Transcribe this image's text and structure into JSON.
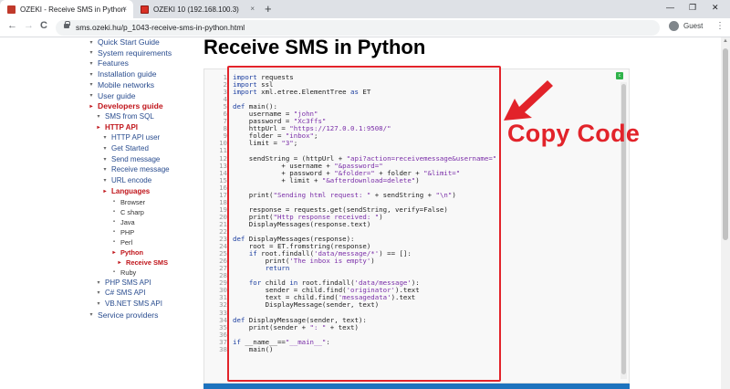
{
  "browser": {
    "tabs": [
      {
        "title": "OZEKI - Receive SMS in Python",
        "active": true,
        "favicon_color": "#c0392b"
      },
      {
        "title": "OZEKI 10 (192.168.100.3)",
        "active": false,
        "favicon_color": "#d93025"
      }
    ],
    "new_tab_label": "+",
    "close_label": "×",
    "window_controls": {
      "minimize": "—",
      "maximize": "❐",
      "close": "✕"
    },
    "nav": {
      "back": "←",
      "forward": "→",
      "reload": "C"
    },
    "url": "sms.ozeki.hu/p_1043-receive-sms-in-python.html",
    "profile_label": "Guest",
    "menu_icon": "⋮"
  },
  "sidebar": {
    "items": [
      {
        "label": "Quick Start Guide",
        "level": 0,
        "active": false
      },
      {
        "label": "System requirements",
        "level": 0,
        "active": false
      },
      {
        "label": "Features",
        "level": 0,
        "active": false
      },
      {
        "label": "Installation guide",
        "level": 0,
        "active": false
      },
      {
        "label": "Mobile networks",
        "level": 0,
        "active": false
      },
      {
        "label": "User guide",
        "level": 0,
        "active": false
      },
      {
        "label": "Developers guide",
        "level": 0,
        "active": true
      },
      {
        "label": "SMS from SQL",
        "level": 1,
        "active": false
      },
      {
        "label": "HTTP API",
        "level": 1,
        "active": true
      },
      {
        "label": "HTTP API user",
        "level": 2,
        "active": false
      },
      {
        "label": "Get Started",
        "level": 2,
        "active": false
      },
      {
        "label": "Send message",
        "level": 2,
        "active": false
      },
      {
        "label": "Receive message",
        "level": 2,
        "active": false
      },
      {
        "label": "URL encode",
        "level": 2,
        "active": false
      },
      {
        "label": "Languages",
        "level": 2,
        "active": true
      },
      {
        "label": "Browser",
        "level": 3,
        "active": false
      },
      {
        "label": "C sharp",
        "level": 3,
        "active": false
      },
      {
        "label": "Java",
        "level": 3,
        "active": false
      },
      {
        "label": "PHP",
        "level": 3,
        "active": false
      },
      {
        "label": "Perl",
        "level": 3,
        "active": false
      },
      {
        "label": "Python",
        "level": 3,
        "active": true
      },
      {
        "label": "Receive SMS",
        "level": 4,
        "active": true
      },
      {
        "label": "Ruby",
        "level": 3,
        "active": false
      },
      {
        "label": "PHP SMS API",
        "level": 1,
        "active": false
      },
      {
        "label": "C# SMS API",
        "level": 1,
        "active": false
      },
      {
        "label": "VB.NET SMS API",
        "level": 1,
        "active": false
      },
      {
        "label": "Service providers",
        "level": 0,
        "active": false
      }
    ]
  },
  "main": {
    "title": "Receive SMS in Python",
    "copy_badge": "c",
    "code_lines": [
      "import requests",
      "import ssl",
      "import xml.etree.ElementTree as ET",
      "",
      "def main():",
      "    username = \"john\"",
      "    password = \"Xc3ffs\"",
      "    httpUrl = \"https://127.0.0.1:9508/\"",
      "    folder = \"inbox\";",
      "    limit = \"3\";",
      "",
      "    sendString = (httpUrl + \"api?action=receivemessage&username=\"",
      "            + username + \"&password=\"",
      "            + password + \"&folder=\" + folder + \"&limit=\"",
      "            + limit + \"&afterdownload=delete\")",
      "",
      "    print(\"Sending html request: \" + sendString + \"\\n\")",
      "",
      "    response = requests.get(sendString, verify=False)",
      "    print(\"Http response received: \")",
      "    DisplayMessages(response.text)",
      "",
      "def DisplayMessages(response):",
      "    root = ET.fromstring(response)",
      "    if root.findall('data/message/*') == []:",
      "        print('The inbox is empty')",
      "        return",
      "",
      "    for child in root.findall('data/message'):",
      "        sender = child.find('originator').text",
      "        text = child.find('messagedata').text",
      "        DisplayMessage(sender, text)",
      "",
      "def DisplayMessage(sender, text):",
      "    print(sender + \": \" + text)",
      "",
      "if __name__==\"__main__\":",
      "    main()"
    ],
    "annotation_label": "Copy Code",
    "annotation_color": "#e2232a"
  }
}
